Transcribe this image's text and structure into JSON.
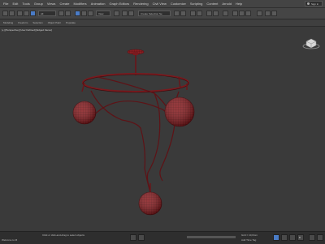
{
  "menu": [
    "File",
    "Edit",
    "Tools",
    "Group",
    "Views",
    "Create",
    "Modifiers",
    "Animation",
    "Graph Editors",
    "Rendering",
    "Civil View",
    "Customize",
    "Scripting",
    "Content",
    "Arnold",
    "Help"
  ],
  "signin_label": "Sign in",
  "toolbar": {
    "filter_value": "All",
    "view_value": "View",
    "selection_set_placeholder": "Create Selection Se"
  },
  "ribbon_tabs": [
    "Modeling",
    "Freeform",
    "Selection",
    "Object Paint",
    "Populate"
  ],
  "viewport": {
    "label": "[+] [Perspective] [User Defined] [Edged Faces]"
  },
  "status": {
    "welcome_text": "Welcome to M",
    "prompt_text": "Click or click-and-drag to select objects",
    "grid_text": "Grid = 10,0mm",
    "add_time_tag": "Add Time Tag",
    "frame_value": "0"
  },
  "colors": {
    "model_red": "#8a1e22",
    "accent_blue": "#4a7cc7"
  },
  "icons": [
    "undo-icon",
    "redo-icon",
    "link-icon",
    "unlink-icon",
    "select-icon",
    "move-icon",
    "rotate-icon",
    "scale-icon",
    "snap-icon",
    "mirror-icon",
    "align-icon",
    "render-icon",
    "play-icon",
    "key-icon",
    "viewcube-icon"
  ]
}
